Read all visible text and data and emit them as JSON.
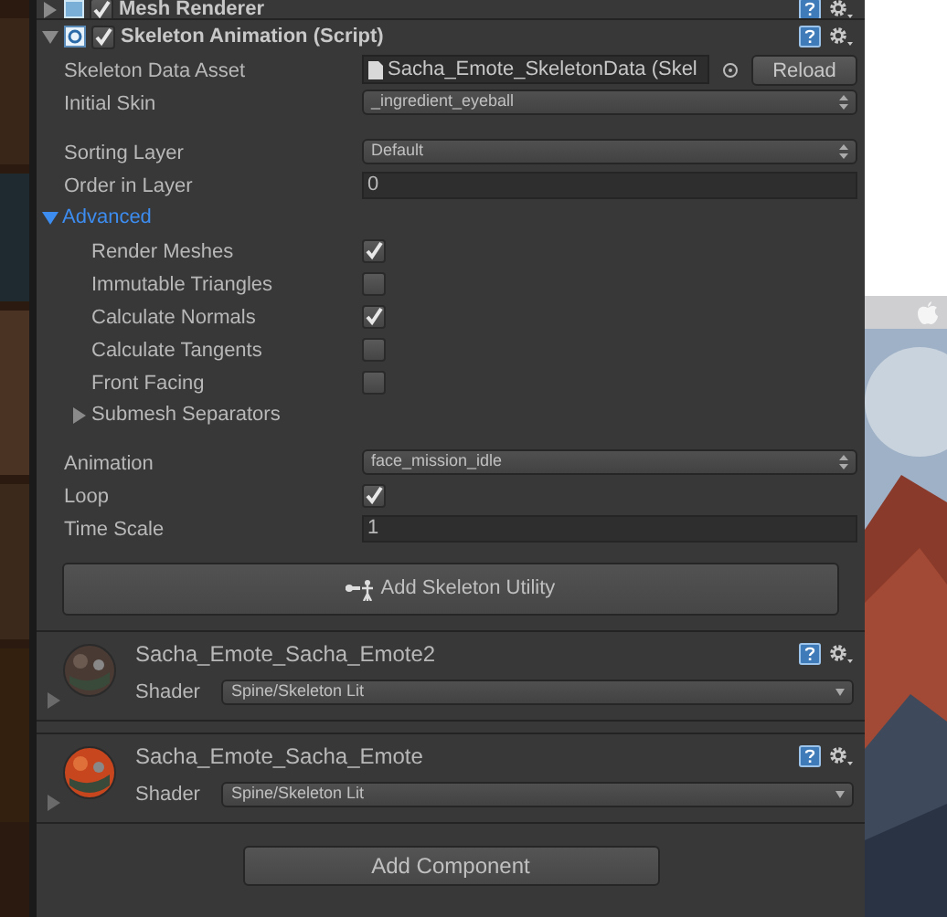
{
  "partial_header": {
    "title": "Mesh Renderer",
    "enabled": true
  },
  "component": {
    "title": "Skeleton Animation (Script)",
    "enabled": true,
    "expanded": true
  },
  "asset_fields": [
    {
      "kind": "object",
      "label": "Skeleton Data Asset",
      "value": "Sacha_Emote_SkeletonData (Skel",
      "button": "Reload"
    },
    {
      "kind": "popup",
      "label": "Initial Skin",
      "value": "_ingredient_eyeball"
    }
  ],
  "sorting_fields": [
    {
      "kind": "popup",
      "label": "Sorting Layer",
      "value": "Default"
    },
    {
      "kind": "number",
      "label": "Order in Layer",
      "value": "0"
    }
  ],
  "advanced": {
    "label": "Advanced",
    "expanded": true,
    "items": [
      {
        "kind": "checkbox",
        "label": "Render Meshes",
        "checked": true
      },
      {
        "kind": "checkbox",
        "label": "Immutable Triangles",
        "checked": false
      },
      {
        "kind": "checkbox",
        "label": "Calculate Normals",
        "checked": true
      },
      {
        "kind": "checkbox",
        "label": "Calculate Tangents",
        "checked": false
      },
      {
        "kind": "checkbox",
        "label": "Front Facing",
        "checked": false
      },
      {
        "kind": "foldout",
        "label": "Submesh Separators",
        "expanded": false
      }
    ]
  },
  "animation_fields": [
    {
      "kind": "popup",
      "label": "Animation",
      "value": "face_mission_idle"
    },
    {
      "kind": "checkbox",
      "label": "Loop",
      "checked": true
    },
    {
      "kind": "number",
      "label": "Time Scale",
      "value": "1"
    }
  ],
  "utility_button": "Add Skeleton Utility",
  "materials": [
    {
      "name": "Sacha_Emote_Sacha_Emote2",
      "shader_label": "Shader",
      "shader": "Spine/Skeleton Lit",
      "expanded": false
    },
    {
      "name": "Sacha_Emote_Sacha_Emote",
      "shader_label": "Shader",
      "shader": "Spine/Skeleton Lit",
      "expanded": false
    }
  ],
  "add_component": "Add Component"
}
